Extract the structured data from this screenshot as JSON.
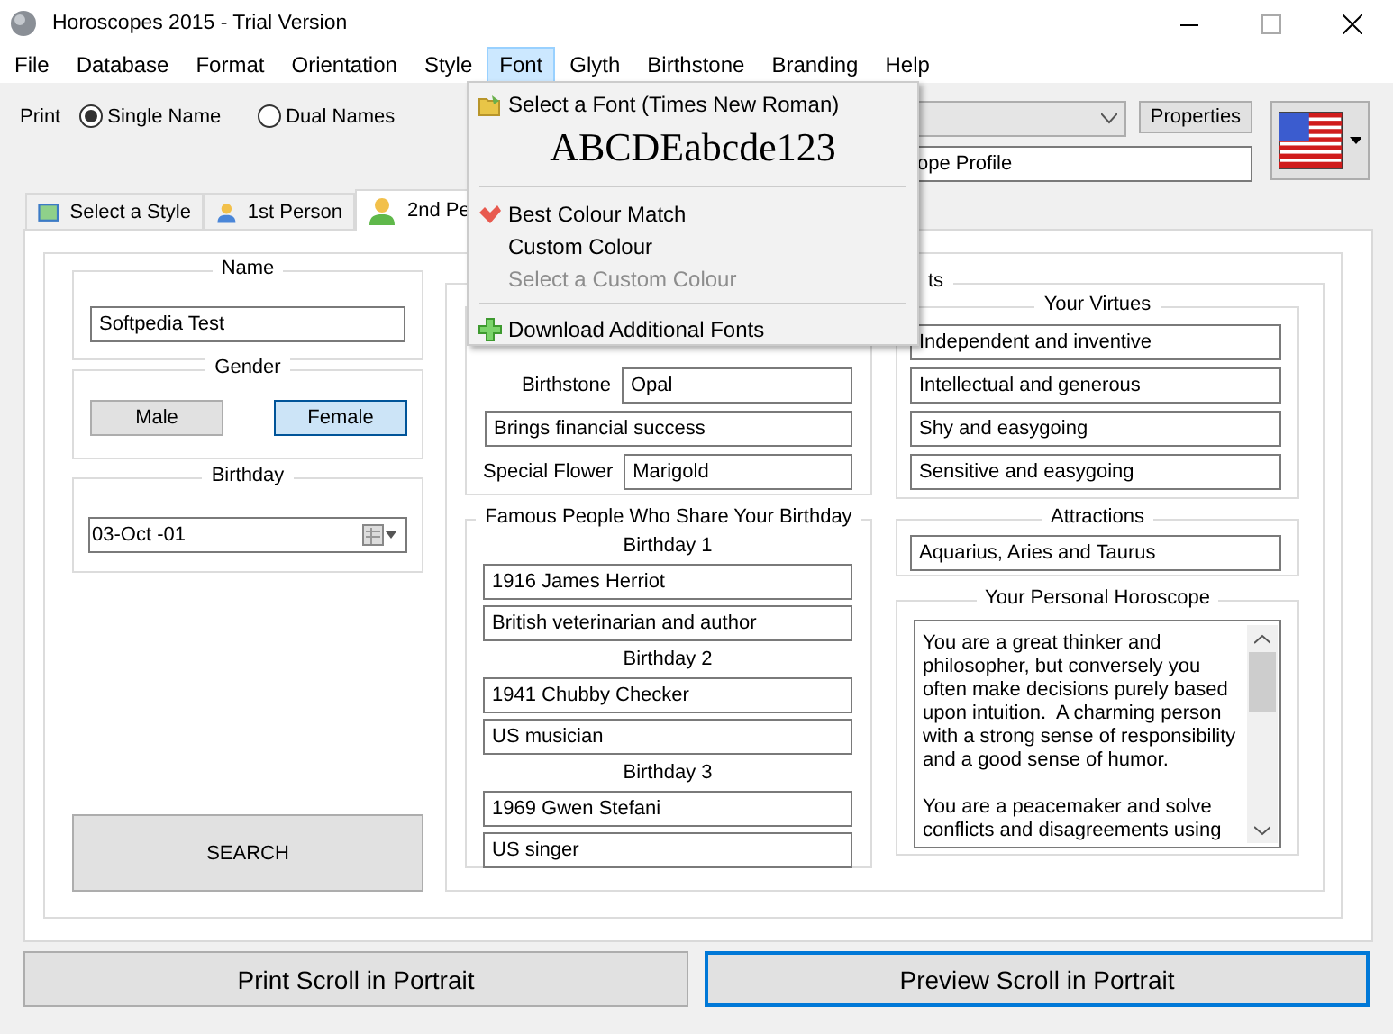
{
  "window": {
    "title": "Horoscopes 2015 - Trial Version"
  },
  "menu_bar": [
    {
      "label": "File",
      "open": false
    },
    {
      "label": "Database",
      "open": false
    },
    {
      "label": "Format",
      "open": false
    },
    {
      "label": "Orientation",
      "open": false
    },
    {
      "label": "Style",
      "open": false
    },
    {
      "label": "Font",
      "open": true
    },
    {
      "label": "Glyth",
      "open": false
    },
    {
      "label": "Birthstone",
      "open": false
    },
    {
      "label": "Branding",
      "open": false
    },
    {
      "label": "Help",
      "open": false
    }
  ],
  "font_menu": {
    "items": [
      {
        "kind": "font_select",
        "label": "Select a Font (Times New Roman)"
      },
      {
        "kind": "preview",
        "label": "ABCDEabcde123"
      },
      {
        "kind": "separator"
      },
      {
        "kind": "option",
        "label": "Best Colour Match",
        "checked": true,
        "disabled": false
      },
      {
        "kind": "option",
        "label": "Custom Colour",
        "checked": false,
        "disabled": false
      },
      {
        "kind": "option",
        "label": "Select a Custom Colour",
        "checked": false,
        "disabled": true
      },
      {
        "kind": "separator"
      },
      {
        "kind": "download",
        "label": "Download Additional Fonts"
      }
    ]
  },
  "print_mode": {
    "label": "Print",
    "options": [
      {
        "label": "Single Name",
        "selected": true
      },
      {
        "label": "Dual Names",
        "selected": false
      }
    ]
  },
  "profile": {
    "properties_button": "Properties",
    "profile_field": "ope Profile"
  },
  "tabs": [
    {
      "kind": "style",
      "label": "Select a Style",
      "selected": false
    },
    {
      "kind": "person",
      "label": "1st Person",
      "selected": false,
      "color": "#4a86d8"
    },
    {
      "kind": "person",
      "label": "2nd Pe",
      "selected": true,
      "color": "#5fb84a"
    }
  ],
  "name": {
    "label": "Name",
    "value": "Softpedia Test"
  },
  "gender": {
    "label": "Gender",
    "options": [
      {
        "label": "Male",
        "selected": false
      },
      {
        "label": "Female",
        "selected": true
      }
    ]
  },
  "birthday": {
    "label": "Birthday",
    "value": "03-Oct -01"
  },
  "search_button": "SEARCH",
  "facts": {
    "title": "ts",
    "traits": [
      {
        "kind": "labeled",
        "label": "Birthstone",
        "value": "Opal"
      },
      {
        "kind": "full",
        "value": "Brings financial success"
      },
      {
        "kind": "labeled",
        "label": "Special Flower",
        "value": "Marigold"
      }
    ],
    "famous": {
      "title": "Famous People Who Share Your Birthday",
      "birthdays": [
        {
          "label": "Birthday 1",
          "name": "1916 James Herriot",
          "note": "British veterinarian and author"
        },
        {
          "label": "Birthday 2",
          "name": "1941 Chubby Checker",
          "note": "US musician"
        },
        {
          "label": "Birthday 3",
          "name": "1969 Gwen Stefani",
          "note": "US singer"
        }
      ]
    },
    "virtues": {
      "title": "Your Virtues",
      "items": [
        "Independent and inventive",
        "Intellectual and generous",
        "Shy and easygoing",
        "Sensitive and easygoing"
      ]
    },
    "attractions": {
      "title": "Attractions",
      "value": "Aquarius, Aries and Taurus"
    },
    "horoscope": {
      "title": "Your Personal Horoscope",
      "text": "You are a great thinker and\nphilosopher, but conversely you\noften make decisions purely based\nupon intuition.  A charming person\nwith a strong sense of responsibility\nand a good sense of humor.\n\nYou are a peacemaker and solve\nconflicts and disagreements using"
    }
  },
  "bottom_buttons": [
    {
      "label": "Print Scroll in Portrait",
      "default": false
    },
    {
      "label": "Preview Scroll in Portrait",
      "default": true
    }
  ]
}
